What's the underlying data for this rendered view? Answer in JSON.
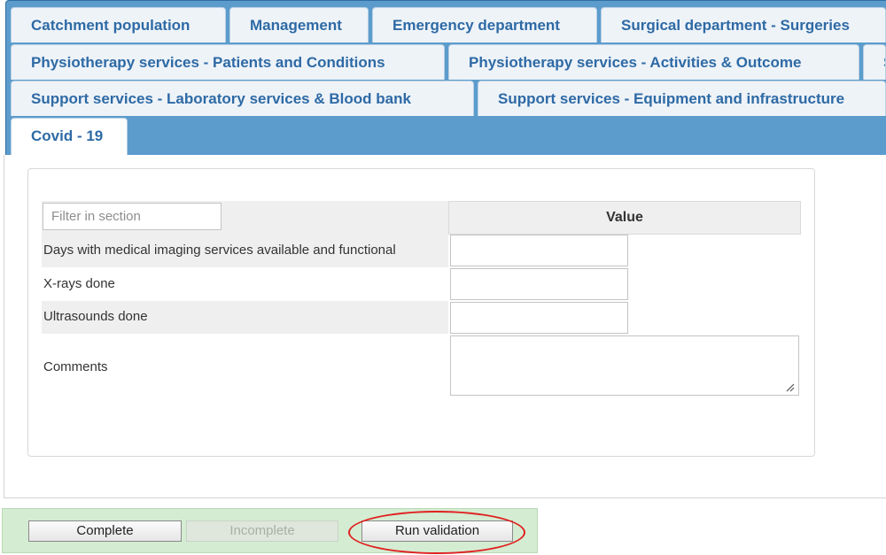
{
  "tabs": [
    {
      "label": "Catchment population",
      "active": false
    },
    {
      "label": "Management",
      "active": false
    },
    {
      "label": "Emergency department",
      "active": false
    },
    {
      "label": "Surgical department - Surgeries",
      "active": false
    },
    {
      "label": "Physiotherapy services - Patients and Conditions",
      "active": false
    },
    {
      "label": "Physiotherapy services - Activities & Outcome",
      "active": false
    },
    {
      "label": "S",
      "active": false
    },
    {
      "label": "Support services - Laboratory services & Blood bank",
      "active": false
    },
    {
      "label": "Support services - Equipment and infrastructure",
      "active": false
    },
    {
      "label": "Covid - 19",
      "active": true
    }
  ],
  "section": {
    "filter_placeholder": "Filter in section",
    "filter_value": "",
    "value_header": "Value",
    "rows": [
      {
        "label": "Days with medical imaging services available and functional",
        "value": ""
      },
      {
        "label": "X-rays done",
        "value": ""
      },
      {
        "label": "Ultrasounds done",
        "value": ""
      },
      {
        "label": "Comments",
        "value": ""
      }
    ]
  },
  "actions": {
    "complete_label": "Complete",
    "incomplete_label": "Incomplete",
    "incomplete_disabled": true,
    "run_validation_label": "Run validation",
    "highlight_color": "#e02020"
  },
  "colors": {
    "tab_band": "#5b9ccd",
    "tab_text": "#2e6aa5",
    "button_bar": "#d4ecd2"
  }
}
